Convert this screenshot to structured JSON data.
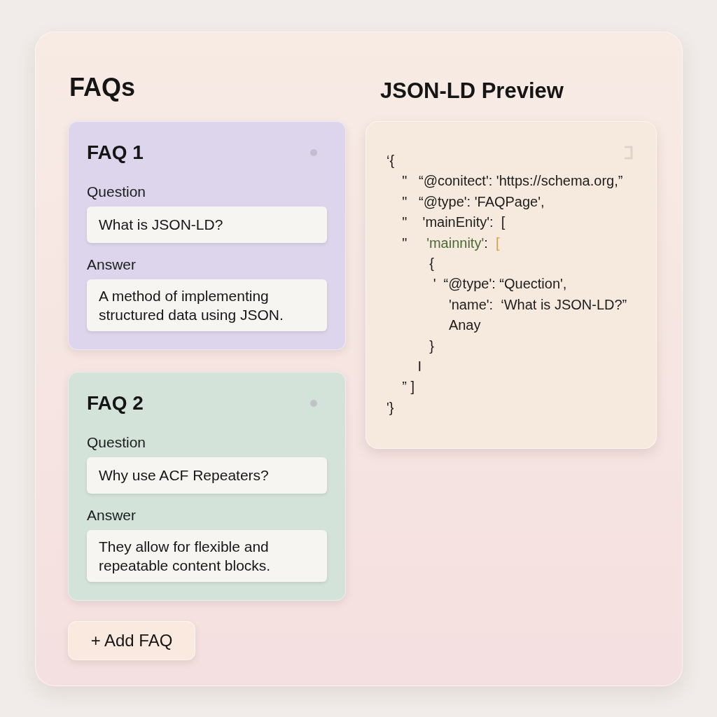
{
  "faqs": {
    "title": "FAQs",
    "items": [
      {
        "title": "FAQ 1",
        "color": "#dcd5ec",
        "question_label": "Question",
        "question": "What is JSON-LD?",
        "answer_label": "Answer",
        "answer": "A method of implementing structured data using JSON."
      },
      {
        "title": "FAQ 2",
        "color": "#d3e3da",
        "question_label": "Question",
        "question": "Why use ACF Repeaters?",
        "answer_label": "Answer",
        "answer": "They allow for flexible and repeatable content blocks."
      }
    ],
    "add_button": "+ Add FAQ"
  },
  "preview": {
    "title": "JSON-LD Preview",
    "code_lines": [
      {
        "segments": [
          {
            "kind": "plain",
            "text": "‘{"
          }
        ]
      },
      {
        "segments": [
          {
            "kind": "plain",
            "text": "    \"   “@conitect': 'https://schema.org,”"
          }
        ]
      },
      {
        "segments": [
          {
            "kind": "plain",
            "text": "    \"   “@type': 'FAQPage',"
          }
        ]
      },
      {
        "segments": [
          {
            "kind": "plain",
            "text": "    \"    'mainEnity':  ["
          }
        ]
      },
      {
        "segments": [
          {
            "kind": "plain",
            "text": "    \"     "
          },
          {
            "kind": "key",
            "text": "'mainnity'"
          },
          {
            "kind": "plain",
            "text": ":  "
          },
          {
            "kind": "bracket",
            "text": "["
          }
        ]
      },
      {
        "segments": [
          {
            "kind": "plain",
            "text": "           {"
          }
        ]
      },
      {
        "segments": [
          {
            "kind": "plain",
            "text": "            '  “@type': “Quection',"
          }
        ]
      },
      {
        "segments": [
          {
            "kind": "plain",
            "text": "                'name':  ‘What is JSON-LD?”"
          }
        ]
      },
      {
        "segments": [
          {
            "kind": "plain",
            "text": "                Anay"
          }
        ]
      },
      {
        "segments": [
          {
            "kind": "plain",
            "text": "           }"
          }
        ]
      },
      {
        "segments": [
          {
            "kind": "plain",
            "text": "        I"
          }
        ]
      },
      {
        "segments": [
          {
            "kind": "plain",
            "text": "    ” ]"
          }
        ]
      },
      {
        "segments": [
          {
            "kind": "plain",
            "text": "'}"
          }
        ]
      }
    ]
  }
}
